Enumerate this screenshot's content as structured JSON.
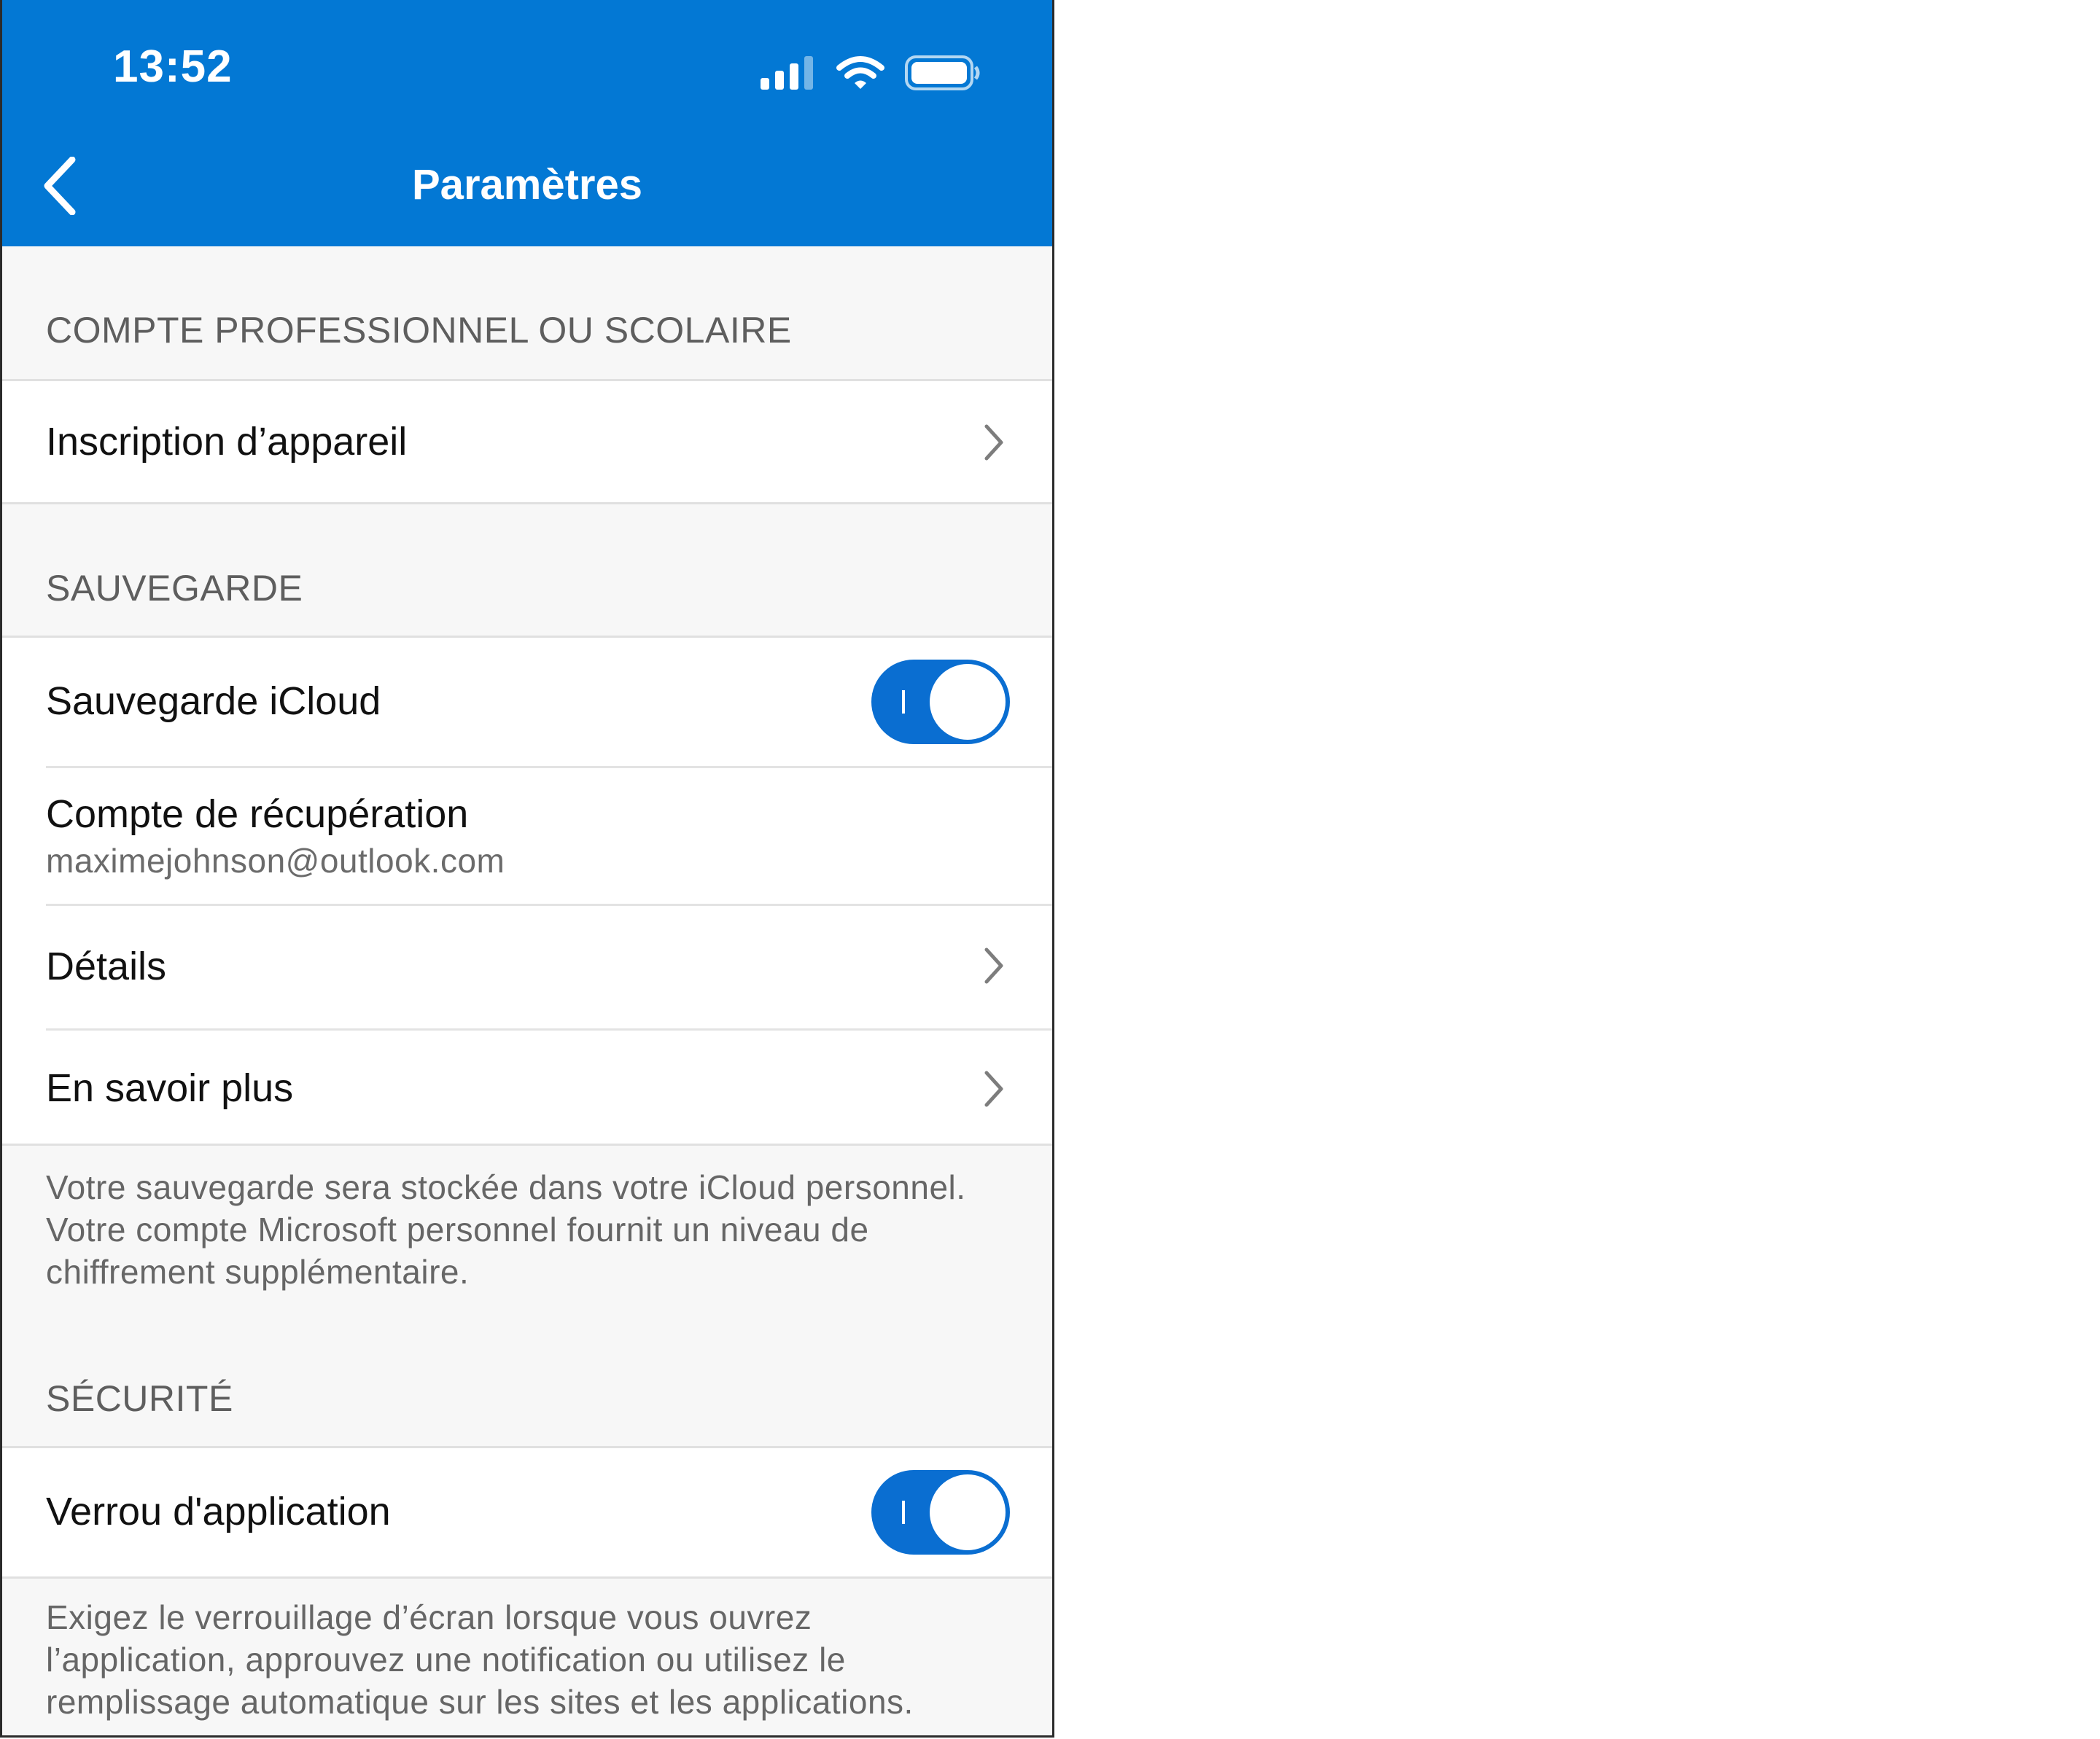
{
  "status_bar": {
    "time": "13:52",
    "icons": [
      "signal-icon",
      "wifi-icon",
      "battery-icon"
    ]
  },
  "nav": {
    "back_icon": "chevron-left-icon",
    "title": "Paramètres"
  },
  "sections": {
    "work_account": {
      "header": "COMPTE PROFESSIONNEL OU SCOLAIRE",
      "device_enrollment_label": "Inscription d’appareil"
    },
    "backup": {
      "header": "SAUVEGARDE",
      "icloud_backup_label": "Sauvegarde iCloud",
      "icloud_backup_on": true,
      "recovery_account_label": "Compte de récupération",
      "recovery_account_value": "maximejohnson@outlook.com",
      "details_label": "Détails",
      "learn_more_label": "En savoir plus",
      "footnote": "Votre sauvegarde sera stockée dans votre iCloud personnel. Votre compte Microsoft personnel fournit un niveau de chiffrement supplémentaire."
    },
    "security": {
      "header": "SÉCURITÉ",
      "app_lock_label": "Verrou d'application",
      "app_lock_on": true,
      "footnote": "Exigez le verrouillage d’écran lorsque vous ouvrez l’application, approuvez une notification ou utilisez le remplissage automatique sur les sites et les applications."
    }
  },
  "colors": {
    "accent": "#0378d4",
    "toggle_on": "#0a6ed1",
    "background": "#f7f7f7",
    "secondary_text": "#5e5e5e"
  }
}
